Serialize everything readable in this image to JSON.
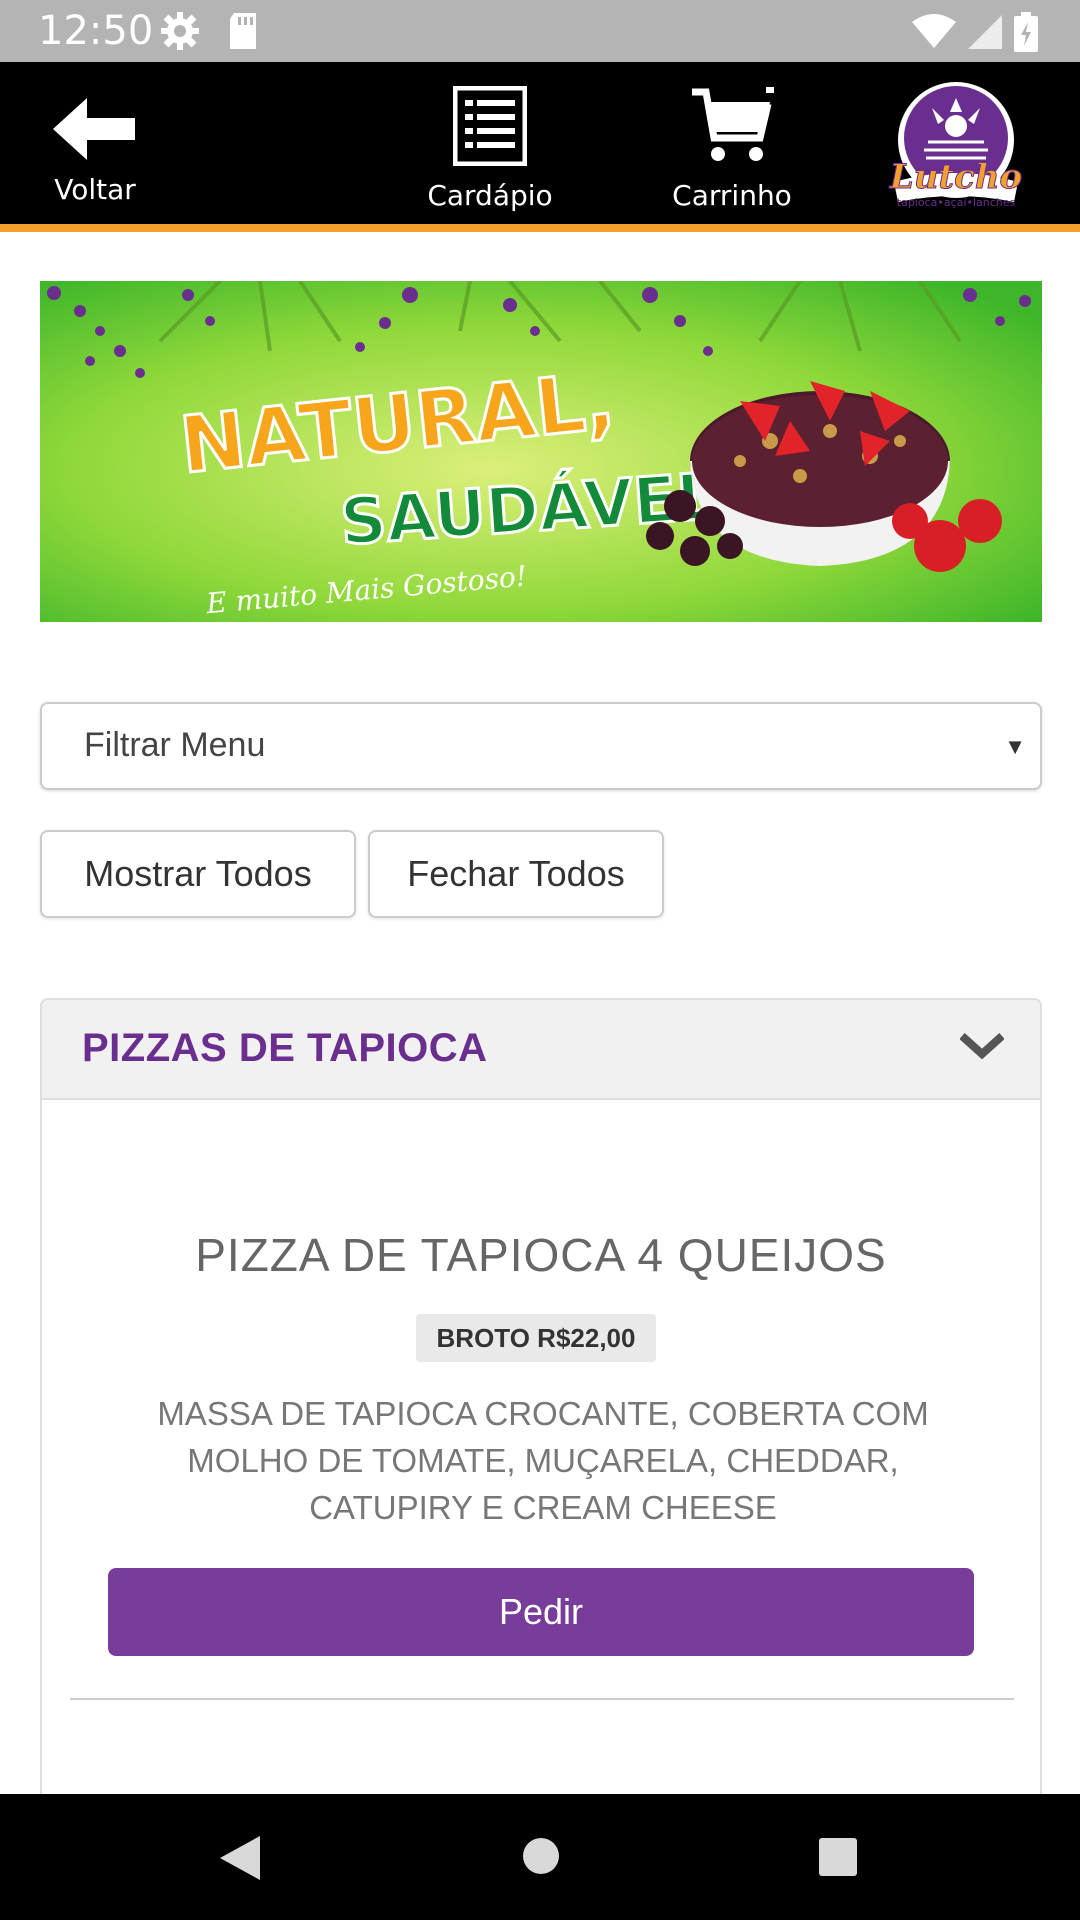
{
  "status_bar": {
    "time": "12:50",
    "icons": [
      "gear-icon",
      "sd-card-icon",
      "wifi-icon",
      "signal-icon",
      "battery-icon"
    ]
  },
  "top_nav": {
    "back_label": "Voltar",
    "menu_label": "Cardápio",
    "cart_label": "Carrinho",
    "logo_text": "Lutcho",
    "logo_tagline": "tapioca•açaí•lanches"
  },
  "banner": {
    "headline_1": "NATURAL,",
    "headline_2": "SAUDÁVEL",
    "tagline": "E muito Mais Gostoso!"
  },
  "filter": {
    "selected": "Filtrar Menu"
  },
  "buttons": {
    "show_all": "Mostrar Todos",
    "close_all": "Fechar Todos"
  },
  "category": {
    "title": "PIZZAS DE TAPIOCA",
    "items": [
      {
        "name": "PIZZA DE TAPIOCA 4 QUEIJOS",
        "price": "BROTO R$22,00",
        "description": "MASSA DE TAPIOCA CROCANTE, COBERTA COM MOLHO DE TOMATE, MUÇARELA, CHEDDAR, CATUPIRY E CREAM CHEESE",
        "order_label": "Pedir"
      }
    ]
  },
  "colors": {
    "accent_purple": "#783c9a",
    "title_purple": "#6a2f8e",
    "nav_border_orange": "#f3a12a"
  }
}
